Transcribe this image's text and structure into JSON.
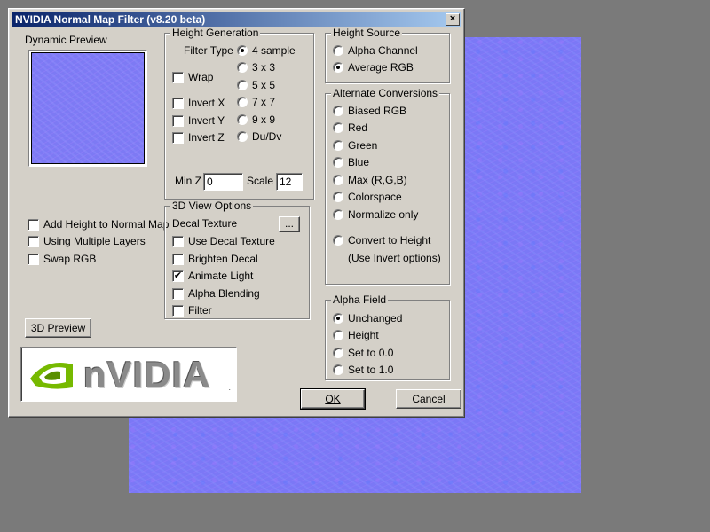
{
  "window": {
    "title": "NVIDIA Normal Map Filter (v8.20 beta)",
    "close_glyph": "×"
  },
  "preview": {
    "label": "Dynamic Preview"
  },
  "left_options": [
    {
      "label": "Add Height to Normal Map",
      "checked": false
    },
    {
      "label": "Using Multiple Layers",
      "checked": false
    },
    {
      "label": "Swap RGB",
      "checked": false
    }
  ],
  "preview3d_button": "3D Preview",
  "logo": {
    "text": "nVIDIA",
    "mark": "."
  },
  "height_generation": {
    "title": "Height Generation",
    "filter_type_label": "Filter Type",
    "filter_types": [
      "4 sample",
      "3 x 3",
      "5 x 5",
      "7 x 7",
      "9 x 9",
      "Du/Dv"
    ],
    "selected_filter": "4 sample",
    "checks": [
      {
        "label": "Wrap",
        "checked": false
      },
      {
        "label": "Invert X",
        "checked": false
      },
      {
        "label": "Invert Y",
        "checked": false
      },
      {
        "label": "Invert Z",
        "checked": false
      }
    ],
    "minz_label": "Min Z",
    "minz_value": "0",
    "scale_label": "Scale",
    "scale_value": "12"
  },
  "view3d": {
    "title": "3D View Options",
    "decal_label": "Decal Texture",
    "browse_label": "...",
    "checks": [
      {
        "label": "Use Decal Texture",
        "checked": false
      },
      {
        "label": "Brighten Decal",
        "checked": false
      },
      {
        "label": "Animate Light",
        "checked": true
      },
      {
        "label": "Alpha Blending",
        "checked": false
      },
      {
        "label": "Filter",
        "checked": false
      }
    ]
  },
  "height_source": {
    "title": "Height Source",
    "options": [
      "Alpha Channel",
      "Average RGB"
    ],
    "selected": "Average RGB"
  },
  "alternate": {
    "title": "Alternate Conversions",
    "options": [
      "Biased RGB",
      "Red",
      "Green",
      "Blue",
      "Max (R,G,B)",
      "Colorspace",
      "Normalize only"
    ],
    "convert_label": "Convert to Height",
    "convert_note": "(Use Invert options)",
    "selected": ""
  },
  "alpha_field": {
    "title": "Alpha Field",
    "options": [
      "Unchanged",
      "Height",
      "Set to 0.0",
      "Set to 1.0"
    ],
    "selected": "Unchanged"
  },
  "buttons": {
    "ok": "OK",
    "cancel": "Cancel"
  },
  "colors": {
    "title_start": "#0a246a",
    "title_end": "#a6caf0",
    "dialog": "#d4d0c8",
    "normal_map": "#7b78f6"
  }
}
